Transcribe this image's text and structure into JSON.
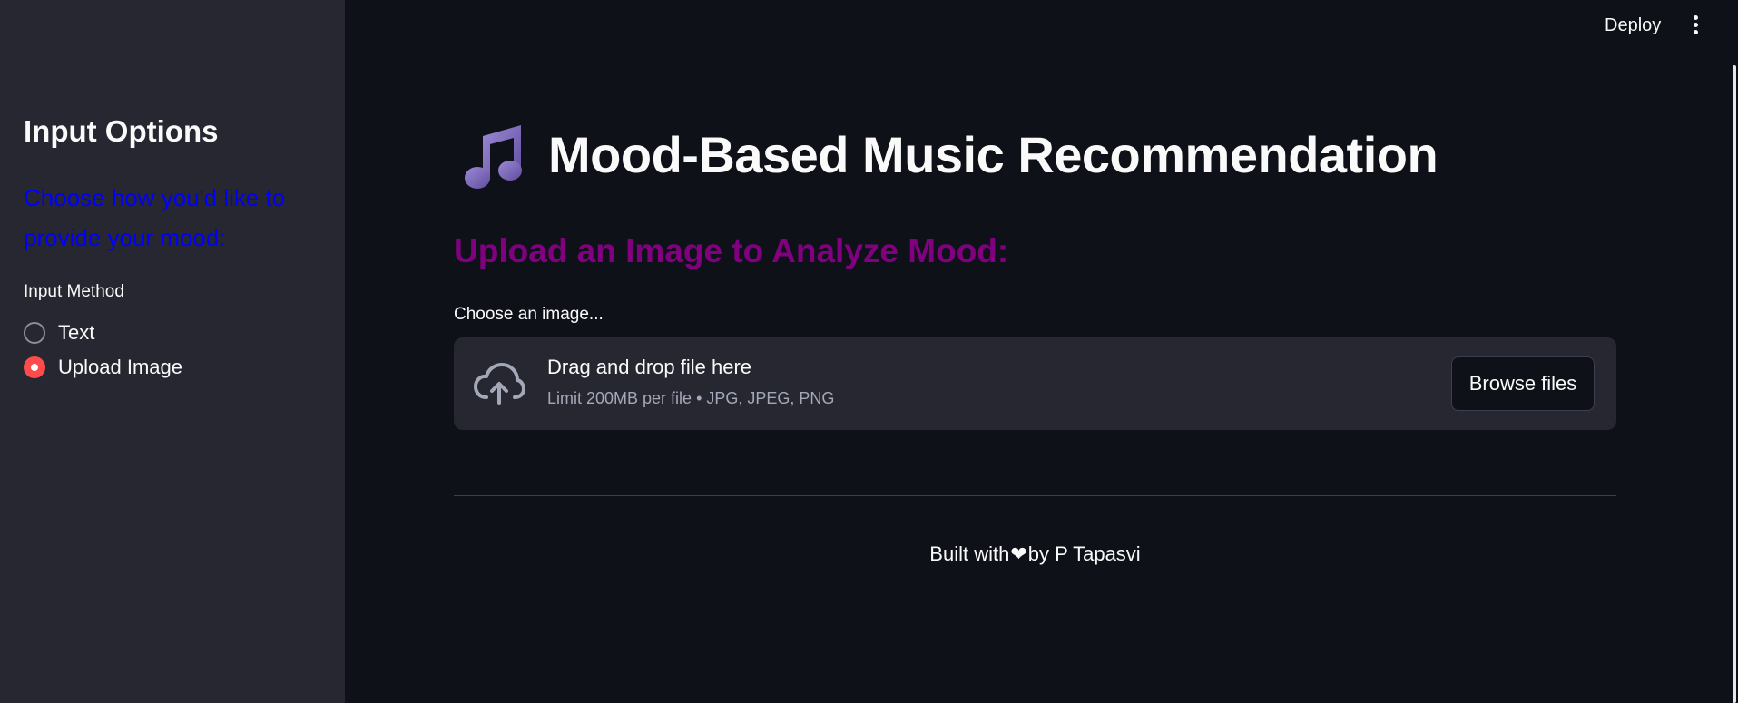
{
  "sidebar": {
    "title": "Input Options",
    "subtitle": "Choose how you'd like to provide your mood:",
    "subtitle_color": "#0000ff",
    "input_method_label": "Input Method",
    "options": [
      {
        "label": "Text",
        "selected": false
      },
      {
        "label": "Upload Image",
        "selected": true
      }
    ],
    "accent_color": "#ff4b4b"
  },
  "header": {
    "deploy_label": "Deploy",
    "menu_icon": "kebab-menu-icon"
  },
  "main": {
    "title_icon": "music-note-icon",
    "title": "Mood-Based Music Recommendation",
    "section_heading": "Upload an Image to Analyze Mood:",
    "section_heading_color": "#800080",
    "uploader": {
      "label": "Choose an image...",
      "dropzone_title": "Drag and drop file here",
      "dropzone_limit": "Limit 200MB per file • JPG, JPEG, PNG",
      "browse_label": "Browse files",
      "icon": "cloud-upload-icon"
    },
    "footer": {
      "prefix": "Built with",
      "heart": "❤",
      "suffix": "by P Tapasvi"
    }
  }
}
